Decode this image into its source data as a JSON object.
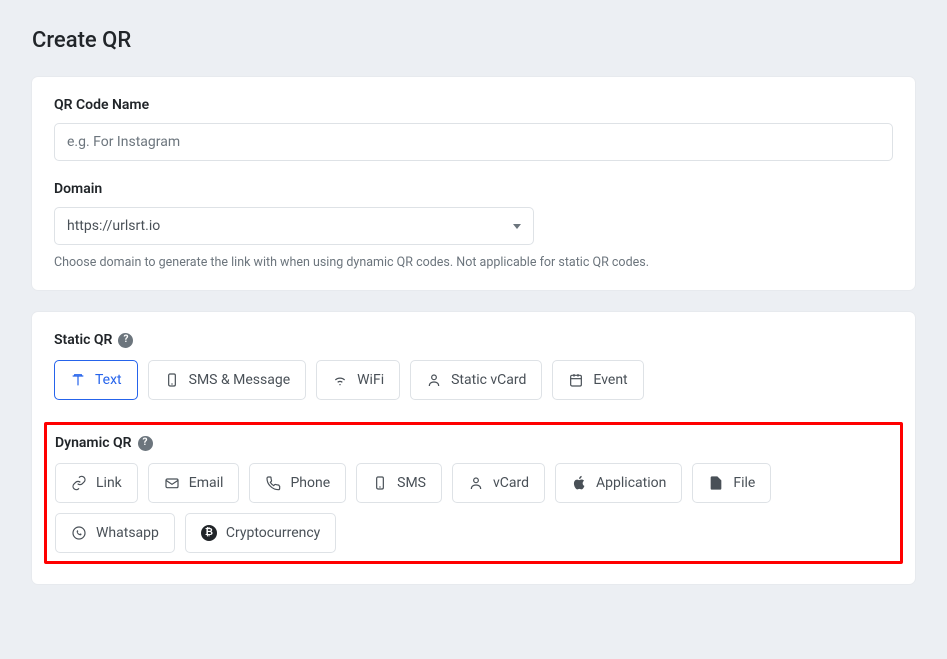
{
  "page": {
    "title": "Create QR"
  },
  "form": {
    "name_label": "QR Code Name",
    "name_placeholder": "e.g. For Instagram",
    "domain_label": "Domain",
    "domain_value": "https://urlsrt.io",
    "domain_help": "Choose domain to generate the link with when using dynamic QR codes. Not applicable for static QR codes."
  },
  "static_qr": {
    "heading": "Static QR",
    "items": [
      {
        "label": "Text",
        "icon": "text-icon",
        "active": true
      },
      {
        "label": "SMS & Message",
        "icon": "smartphone-icon",
        "active": false
      },
      {
        "label": "WiFi",
        "icon": "wifi-icon",
        "active": false
      },
      {
        "label": "Static vCard",
        "icon": "user-icon",
        "active": false
      },
      {
        "label": "Event",
        "icon": "calendar-icon",
        "active": false
      }
    ]
  },
  "dynamic_qr": {
    "heading": "Dynamic QR",
    "items": [
      {
        "label": "Link",
        "icon": "link-icon"
      },
      {
        "label": "Email",
        "icon": "mail-icon"
      },
      {
        "label": "Phone",
        "icon": "phone-icon"
      },
      {
        "label": "SMS",
        "icon": "smartphone-icon"
      },
      {
        "label": "vCard",
        "icon": "user-icon"
      },
      {
        "label": "Application",
        "icon": "apple-icon"
      },
      {
        "label": "File",
        "icon": "file-icon"
      },
      {
        "label": "Whatsapp",
        "icon": "whatsapp-icon"
      },
      {
        "label": "Cryptocurrency",
        "icon": "crypto-icon"
      }
    ]
  }
}
